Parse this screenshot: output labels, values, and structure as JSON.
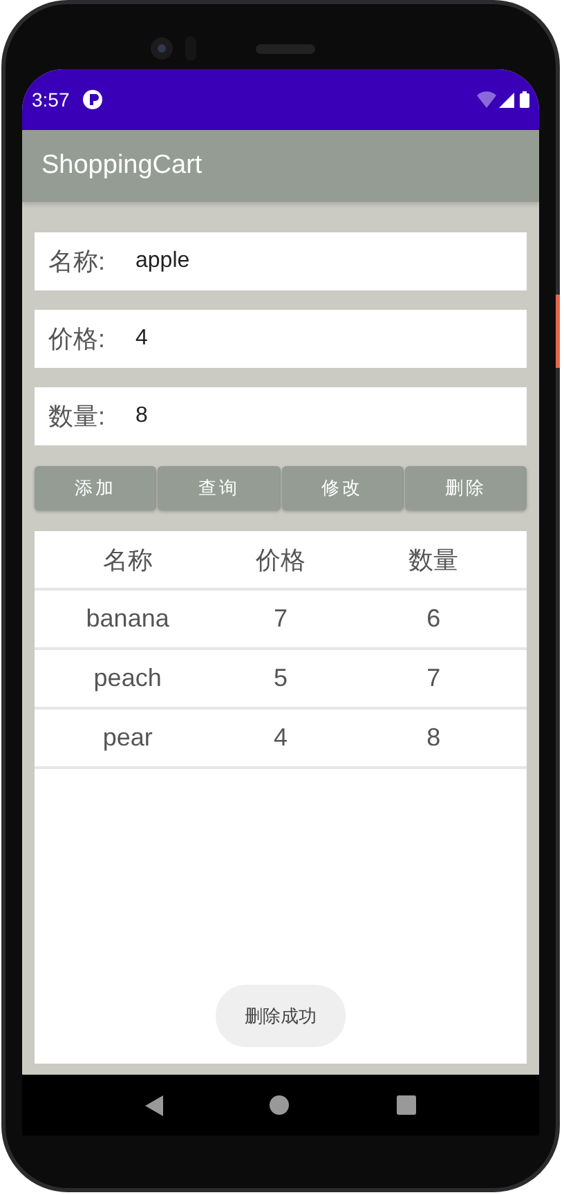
{
  "status_bar": {
    "time": "3:57"
  },
  "app_bar": {
    "title": "ShoppingCart"
  },
  "form": [
    {
      "label": "名称:",
      "value": "apple"
    },
    {
      "label": "价格:",
      "value": "4"
    },
    {
      "label": "数量:",
      "value": "8"
    }
  ],
  "buttons": [
    "添加",
    "查询",
    "修改",
    "删除"
  ],
  "table": {
    "columns": [
      "名称",
      "价格",
      "数量"
    ],
    "rows": [
      [
        "banana",
        "7",
        "6"
      ],
      [
        "peach",
        "5",
        "7"
      ],
      [
        "pear",
        "4",
        "8"
      ]
    ]
  },
  "toast": "删除成功"
}
